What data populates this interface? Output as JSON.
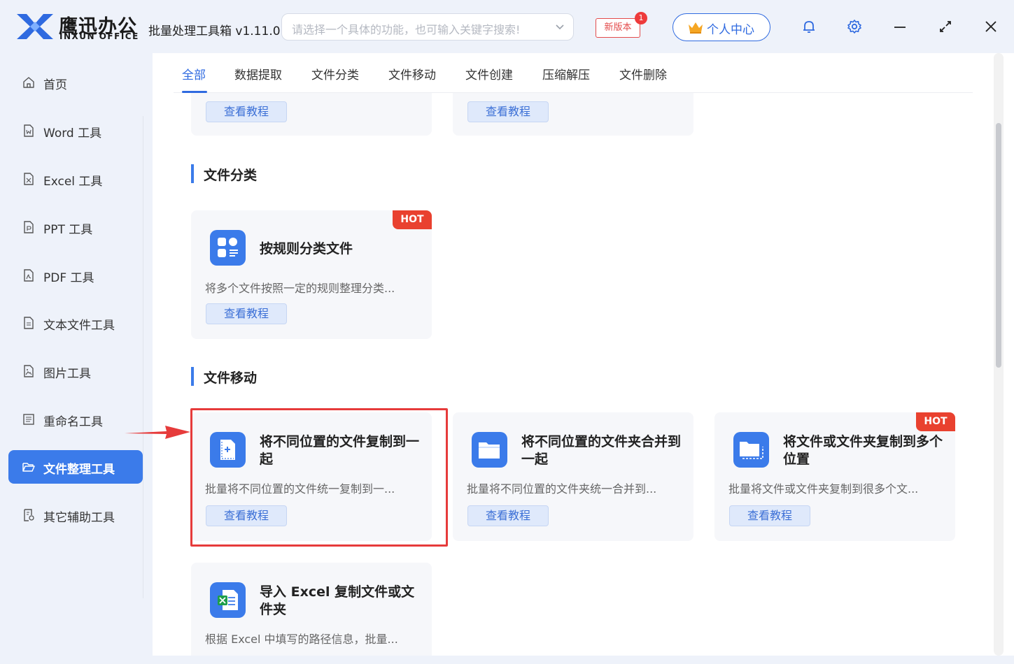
{
  "titlebar": {
    "logo_cn": "鹰迅办公",
    "logo_en": "INXUN OFFICE",
    "app_title": "批量处理工具箱 v1.11.0",
    "search_placeholder": "请选择一个具体的功能，也可输入关键字搜索!",
    "new_version_label": "新版本",
    "new_version_badge": "1",
    "profile_label": "个人中心",
    "icons": [
      "bell-icon",
      "gear-icon",
      "minimize-icon",
      "maximize-icon",
      "close-icon"
    ]
  },
  "sidebar": {
    "items": [
      {
        "label": "首页",
        "icon": "home-icon"
      },
      {
        "label": "Word 工具",
        "icon": "word-doc-icon"
      },
      {
        "label": "Excel 工具",
        "icon": "excel-doc-icon"
      },
      {
        "label": "PPT 工具",
        "icon": "ppt-doc-icon"
      },
      {
        "label": "PDF 工具",
        "icon": "pdf-doc-icon"
      },
      {
        "label": "文本文件工具",
        "icon": "text-doc-icon"
      },
      {
        "label": "图片工具",
        "icon": "image-doc-icon"
      },
      {
        "label": "重命名工具",
        "icon": "rename-icon"
      },
      {
        "label": "文件整理工具",
        "icon": "folder-open-icon",
        "active": true
      },
      {
        "label": "其它辅助工具",
        "icon": "misc-tool-icon"
      }
    ]
  },
  "tabs": [
    {
      "label": "全部",
      "active": true
    },
    {
      "label": "数据提取"
    },
    {
      "label": "文件分类"
    },
    {
      "label": "文件移动"
    },
    {
      "label": "文件创建"
    },
    {
      "label": "压缩解压"
    },
    {
      "label": "文件删除"
    }
  ],
  "top_partial": {
    "btn1": "查看教程",
    "btn2": "查看教程"
  },
  "sections": {
    "classify": {
      "title": "文件分类",
      "cards": [
        {
          "title": "按规则分类文件",
          "desc": "将多个文件按照一定的规则整理分类...",
          "button": "查看教程",
          "hot": "HOT",
          "icon": "classify-icon"
        }
      ]
    },
    "move": {
      "title": "文件移动",
      "cards": [
        {
          "title": "将不同位置的文件复制到一起",
          "desc": "批量将不同位置的文件统一复制到一...",
          "button": "查看教程",
          "icon": "file-copy-icon"
        },
        {
          "title": "将不同位置的文件夹合并到一起",
          "desc": "批量将不同位置的文件夹统一合并到...",
          "button": "查看教程",
          "icon": "folder-merge-icon"
        },
        {
          "title": "将文件或文件夹复制到多个位置",
          "desc": "批量将文件或文件夹复制到很多个文...",
          "button": "查看教程",
          "hot": "HOT",
          "icon": "folder-multi-icon"
        },
        {
          "title": "导入 Excel 复制文件或文件夹",
          "desc": "根据 Excel 中填写的路径信息，批量...",
          "icon": "excel-import-icon"
        }
      ]
    }
  },
  "colors": {
    "accent": "#3b7bea",
    "hot": "#e9412f",
    "highlight": "#e63b3b"
  }
}
